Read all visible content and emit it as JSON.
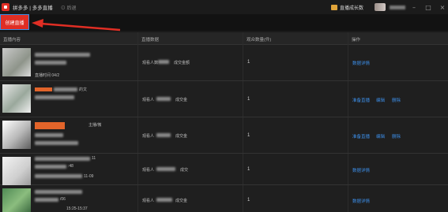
{
  "titlebar": {
    "app_title": "拼多多 | 多多直播",
    "back_label": "⊙ 后退",
    "growth_label": "直播成长数"
  },
  "toolbar": {
    "create_button": "创建直播"
  },
  "table": {
    "columns": [
      "直播内容",
      "直播数据",
      "观众数量(件)",
      "操作"
    ],
    "rows": [
      {
        "date_text": "直播时间 04/2",
        "data_a": "观看人数",
        "data_b": "成交金额",
        "count": "1",
        "actions": [
          "数据详情"
        ]
      },
      {
        "date_text": "",
        "extra_text": "的文",
        "data_a": "观看人",
        "data_b": "成交金",
        "count": "1",
        "actions": [
          "准备直播",
          "编辑",
          "删除"
        ]
      },
      {
        "date_text": "",
        "extra_text": "主播/微",
        "data_a": "观看人",
        "data_b": "成交金",
        "count": "1",
        "actions": [
          "准备直播",
          "编辑",
          "删除"
        ]
      },
      {
        "date_text": "11-09",
        "extra_text": "11",
        "sub_text": ":48",
        "data_a": "观看人",
        "data_b": "成交",
        "count": "1",
        "actions": [
          "数据详情"
        ]
      },
      {
        "date_text": "15:25-15:37",
        "sub_text": "/06",
        "data_a": "观看人",
        "data_b": "成交金",
        "count": "1",
        "actions": [
          "数据详情"
        ]
      }
    ]
  },
  "colors": {
    "accent_red": "#e02e24",
    "link_blue": "#3c8ee8",
    "arrow_red": "#e02e24"
  }
}
